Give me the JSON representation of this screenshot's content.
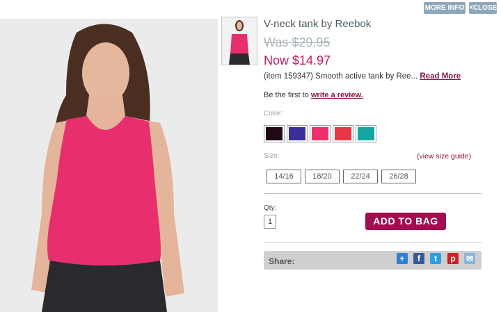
{
  "top_buttons": {
    "more_info": "MORE INFO",
    "close": "CLOSE"
  },
  "product": {
    "title": "V-neck tank by Reebok",
    "was_price": "Was $29.95",
    "now_price": "Now $14.97",
    "description": "(item 159347) Smooth active tank by Ree...",
    "read_more": "Read More",
    "review_prefix": "Be the first to",
    "review_link": "write a review."
  },
  "color": {
    "label": "Color:",
    "swatches": [
      "#1e0a14",
      "#3b2f9b",
      "#f0306a",
      "#ea3542",
      "#13a7a1"
    ]
  },
  "size": {
    "label": "Size:",
    "guide": "(view size guide)",
    "options": [
      "14/16",
      "18/20",
      "22/24",
      "26/28"
    ]
  },
  "qty": {
    "label": "Qty:",
    "value": "1"
  },
  "add_to_bag": "ADD TO BAG",
  "share": {
    "label": "Share:",
    "icons": [
      "add-share-icon",
      "facebook-icon",
      "twitter-icon",
      "pinterest-icon",
      "email-icon"
    ]
  }
}
